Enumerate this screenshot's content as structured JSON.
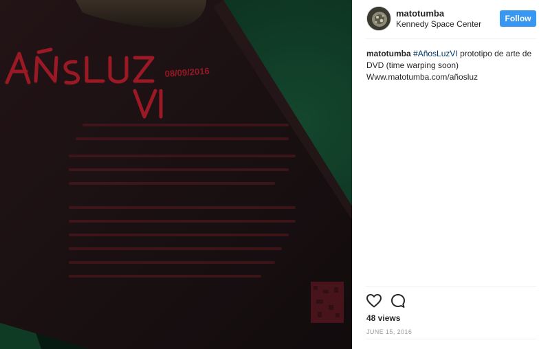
{
  "header": {
    "username": "matotumba",
    "location": "Kennedy Space Center",
    "follow_label": "Follow"
  },
  "caption": {
    "username": "matotumba",
    "hashtag": "#AñosLuzVI",
    "text_line": " prototipo de arte de DVD (time warping soon)",
    "link": "Www.matotumba.com/añosluz"
  },
  "media": {
    "title_word": "AÑOSLUZ",
    "subtitle_word": "VI",
    "tagline": "08/09/2016"
  },
  "actions": {
    "like_icon": "heart-icon",
    "comment_icon": "comment-bubble-icon"
  },
  "stats": {
    "views_label": "48 views"
  },
  "date": "JUNE 15, 2016",
  "colors": {
    "accent": "#3897f0",
    "hashtag": "#003569",
    "text": "#262626",
    "muted": "#999999",
    "media_red": "#c81e2c",
    "media_green": "#0f3b25"
  }
}
